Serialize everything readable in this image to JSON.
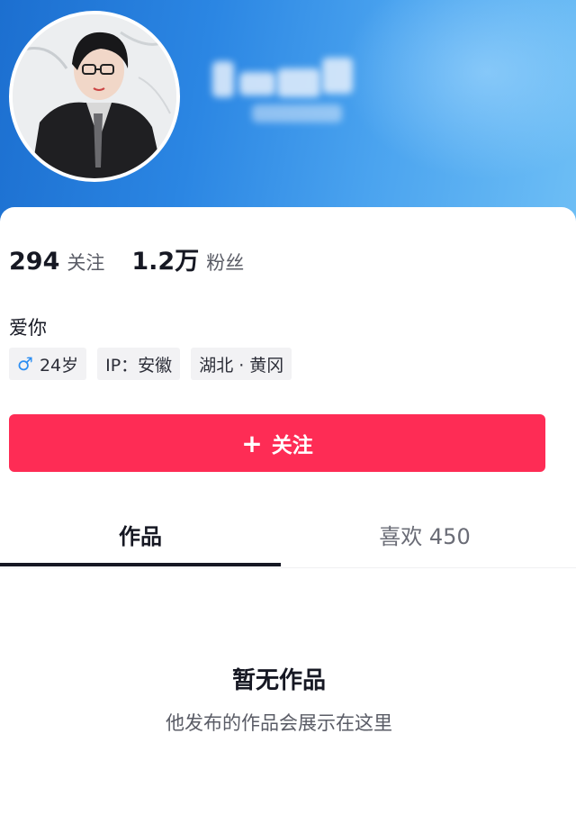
{
  "profile": {
    "following_count": "294",
    "following_label": "关注",
    "followers_count": "1.2万",
    "followers_label": "粉丝",
    "bio": "爱你",
    "tags": {
      "gender_icon": "♂",
      "age": "24岁",
      "ip": "IP：安徽",
      "location": "湖北 · 黄冈"
    }
  },
  "actions": {
    "follow_icon": "+",
    "follow_label": "关注"
  },
  "tabs": {
    "works": "作品",
    "likes": "喜欢 450"
  },
  "empty_state": {
    "title": "暂无作品",
    "subtitle": "他发布的作品会展示在这里"
  },
  "colors": {
    "accent": "#fe2c55",
    "header_blue": "#2b86e3",
    "gender_blue": "#2c8ef2"
  },
  "icons": {
    "gender": "male-icon",
    "follow": "plus-icon"
  }
}
